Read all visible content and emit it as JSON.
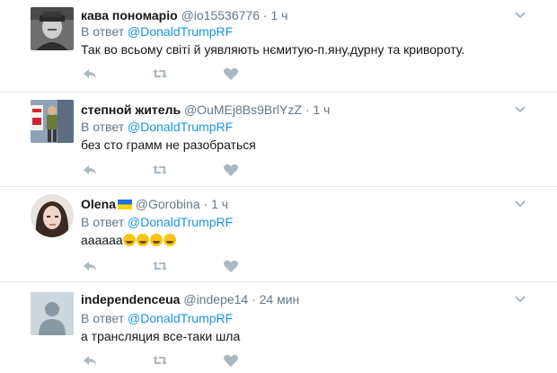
{
  "tweets": [
    {
      "name": "кава пономаріо",
      "handle": "@io15536776",
      "dot": "·",
      "time": "1 ч",
      "reply_prefix": "В ответ",
      "reply_to": "@DonaldTrumpRF",
      "text": "Так во всьому світі й уявляють нємитую-п.яну,дурну та кривороту."
    },
    {
      "name": "степной житель",
      "handle": "@OuMEj8Bs9BrlYzZ",
      "dot": "·",
      "time": "1 ч",
      "reply_prefix": "В ответ",
      "reply_to": "@DonaldTrumpRF",
      "text": "без сто грамм не разобраться"
    },
    {
      "name": "Olena",
      "handle": "@Gorobina",
      "dot": "·",
      "time": "1 ч",
      "reply_prefix": "В ответ",
      "reply_to": "@DonaldTrumpRF",
      "text": "аааааа",
      "emoji_count": 4
    },
    {
      "name": "independenceua",
      "handle": "@indepe14",
      "dot": "·",
      "time": "24 мин",
      "reply_prefix": "В ответ",
      "reply_to": "@DonaldTrumpRF",
      "text": "а трансляция все-таки шла"
    }
  ],
  "icons": {
    "reply": "reply-icon",
    "retweet": "retweet-icon",
    "like": "heart-icon",
    "more": "chevron-down-icon",
    "flag": "ukraine-flag-icon"
  },
  "colors": {
    "link": "#1b95e0",
    "muted": "#657786",
    "icon": "#aab8c2",
    "divider": "#e6ecf0"
  }
}
